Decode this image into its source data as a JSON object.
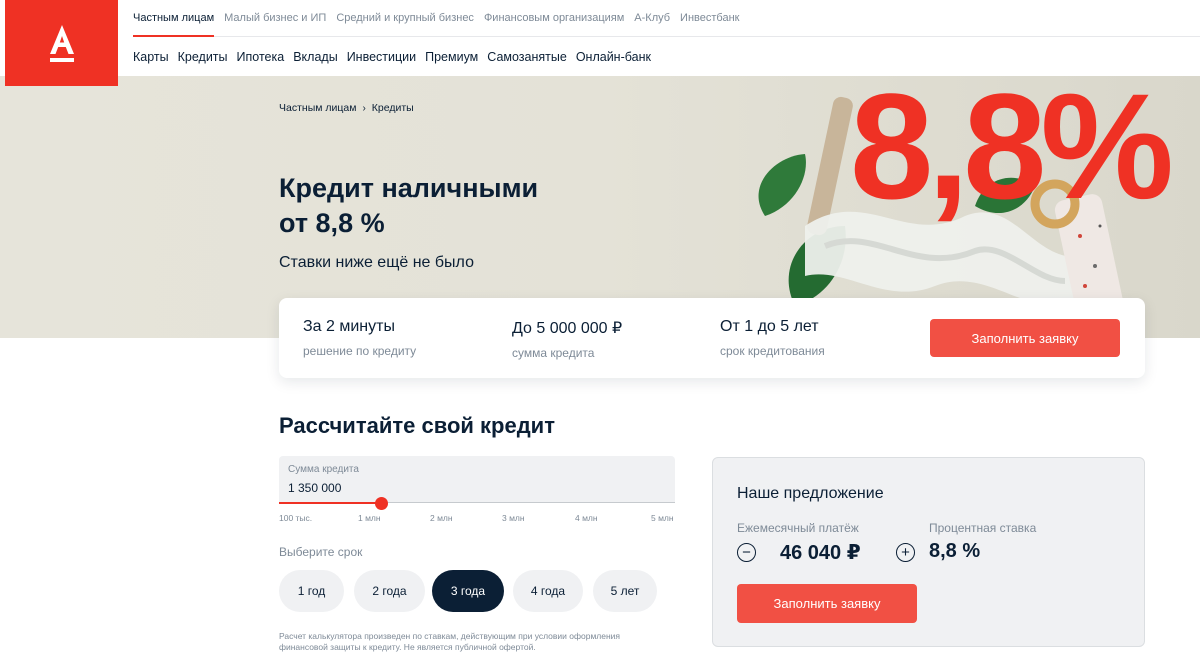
{
  "brand": {
    "logo_letter": "А",
    "accent": "#ef3124"
  },
  "topnav": [
    "Частным лицам",
    "Малый бизнес и ИП",
    "Средний и крупный бизнес",
    "Финансовым организациям",
    "А-Клуб",
    "Инвестбанк"
  ],
  "subnav": [
    "Карты",
    "Кредиты",
    "Ипотека",
    "Вклады",
    "Инвестиции",
    "Премиум",
    "Самозанятые",
    "Онлайн-банк"
  ],
  "breadcrumb": {
    "home": "Частным лицам",
    "sep": "›",
    "current": "Кредиты"
  },
  "hero": {
    "title_line1": "Кредит наличными",
    "title_line2": "от 8,8 %",
    "subtitle": "Ставки ниже ещё не было",
    "big_rate": "8,8%"
  },
  "benefits": [
    {
      "title": "За 2 минуты",
      "subtitle": "решение по кредиту"
    },
    {
      "title": "До 5 000 000 ₽",
      "subtitle": "сумма кредита"
    },
    {
      "title": "От 1 до 5 лет",
      "subtitle": "срок кредитования"
    }
  ],
  "apply_button": "Заполнить заявку",
  "calculator": {
    "title": "Рассчитайте свой кредит",
    "sum_label": "Сумма кредита",
    "sum_value": "1 350 000",
    "slider_fraction": 0.26,
    "ticks": [
      "100 тыс.",
      "1 млн",
      "2 млн",
      "3 млн",
      "4 млн",
      "5 млн"
    ],
    "term_label": "Выберите срок",
    "terms": [
      "1 год",
      "2 года",
      "3 года",
      "4 года",
      "5 лет"
    ],
    "selected_term": "3 года",
    "disclaimer": "Расчет калькулятора произведен по ставкам, действующим при условии оформления финансовой защиты к кредиту. Не является публичной офертой."
  },
  "offer": {
    "title": "Наше предложение",
    "payment_label": "Ежемесячный платёж",
    "payment_value": "46 040 ₽",
    "rate_label": "Процентная ставка",
    "rate_value": "8,8 %",
    "minus": "−",
    "plus": "+",
    "button": "Заполнить заявку"
  }
}
